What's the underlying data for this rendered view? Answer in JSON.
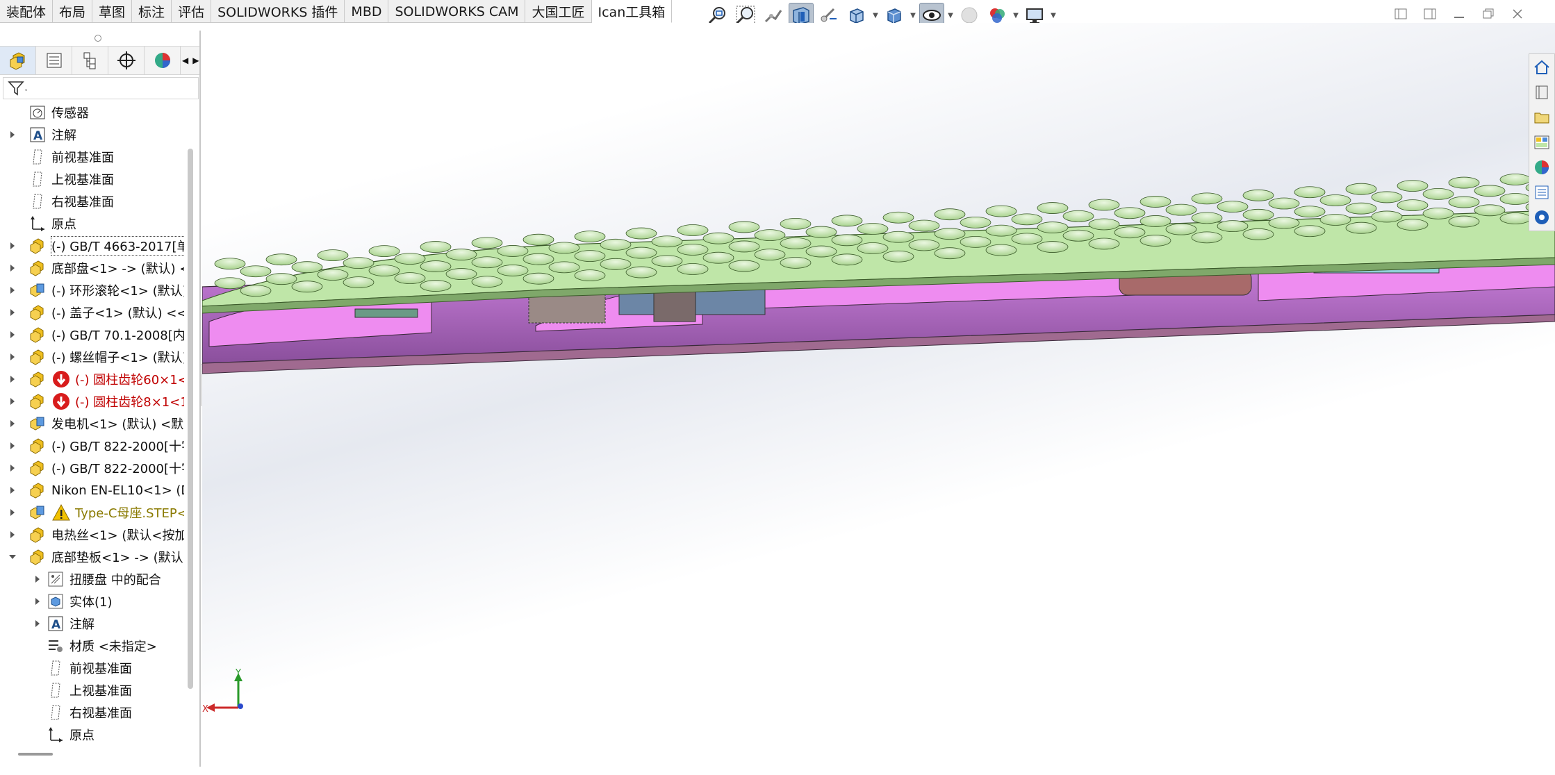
{
  "command_tabs": [
    {
      "label": "装配体"
    },
    {
      "label": "布局"
    },
    {
      "label": "草图"
    },
    {
      "label": "标注"
    },
    {
      "label": "评估"
    },
    {
      "label": "SOLIDWORKS 插件"
    },
    {
      "label": "MBD"
    },
    {
      "label": "SOLIDWORKS CAM"
    },
    {
      "label": "大国工匠"
    },
    {
      "label": "Ican工具箱"
    }
  ],
  "heads_up_toolbar": [
    "zoom-to-fit-icon",
    "zoom-to-area-icon",
    "previous-view-icon",
    "section-view-icon",
    "dynamic-annotation-icon",
    "view-orientation-icon",
    "display-style-icon",
    "hide-show-items-icon",
    "edit-appearance-icon",
    "apply-scene-icon",
    "view-settings-icon"
  ],
  "feature_manager": {
    "tabs": [
      "feature-manager-icon",
      "property-manager-icon",
      "configuration-manager-icon",
      "dimxpert-icon",
      "display-manager-icon"
    ],
    "tree": [
      {
        "label": "传感器",
        "icon": "sensor-icon"
      },
      {
        "label": "注解",
        "icon": "annotation-icon"
      },
      {
        "label": "前视基准面",
        "icon": "plane-icon"
      },
      {
        "label": "上视基准面",
        "icon": "plane-icon"
      },
      {
        "label": "右视基准面",
        "icon": "plane-icon"
      },
      {
        "label": "原点",
        "icon": "origin-icon"
      },
      {
        "label": "(-) GB/T 4663-2017[单",
        "icon": "part-icon"
      },
      {
        "label": "底部盘<1> -> (默认) <",
        "icon": "part-icon"
      },
      {
        "label": "(-) 环形滚轮<1> (默认)",
        "icon": "assembly-icon"
      },
      {
        "label": "(-) 盖子<1> (默认) <<默",
        "icon": "part-icon"
      },
      {
        "label": "(-) GB/T 70.1-2008[内",
        "icon": "part-icon"
      },
      {
        "label": "(-) 螺丝帽子<1> (默认)",
        "icon": "part-icon"
      },
      {
        "label": "(-) 圆柱齿轮60×1<",
        "icon": "part-icon"
      },
      {
        "label": "(-) 圆柱齿轮8×1<1",
        "icon": "part-icon"
      },
      {
        "label": "发电机<1> (默认) <默认",
        "icon": "assembly-icon"
      },
      {
        "label": "(-) GB/T 822-2000[十字",
        "icon": "part-icon"
      },
      {
        "label": "(-) GB/T 822-2000[十字",
        "icon": "part-icon"
      },
      {
        "label": "Nikon EN-EL10<1> (D",
        "icon": "part-icon"
      },
      {
        "label": "Type-C母座.STEP<",
        "icon": "assembly-icon"
      },
      {
        "label": "电热丝<1> (默认<按加",
        "icon": "part-icon"
      },
      {
        "label": "底部垫板<1> -> (默认)",
        "icon": "part-icon"
      },
      {
        "label": "扭腰盘 中的配合",
        "icon": "mates-icon"
      },
      {
        "label": "实体(1)",
        "icon": "solid-bodies-icon"
      },
      {
        "label": "注解",
        "icon": "annotation-icon"
      },
      {
        "label": "材质 <未指定>",
        "icon": "material-icon"
      },
      {
        "label": "前视基准面",
        "icon": "plane-icon"
      },
      {
        "label": "上视基准面",
        "icon": "plane-icon"
      },
      {
        "label": "右视基准面",
        "icon": "plane-icon"
      },
      {
        "label": "原点",
        "icon": "origin-icon"
      }
    ]
  },
  "triad": {
    "x_label": "X",
    "y_label": "Y"
  },
  "colors": {
    "top_surface": "#bfe6a8",
    "section_purple": "#c77ee0",
    "section_magenta": "#ee8cf0",
    "accent": "#1f5fb8"
  }
}
